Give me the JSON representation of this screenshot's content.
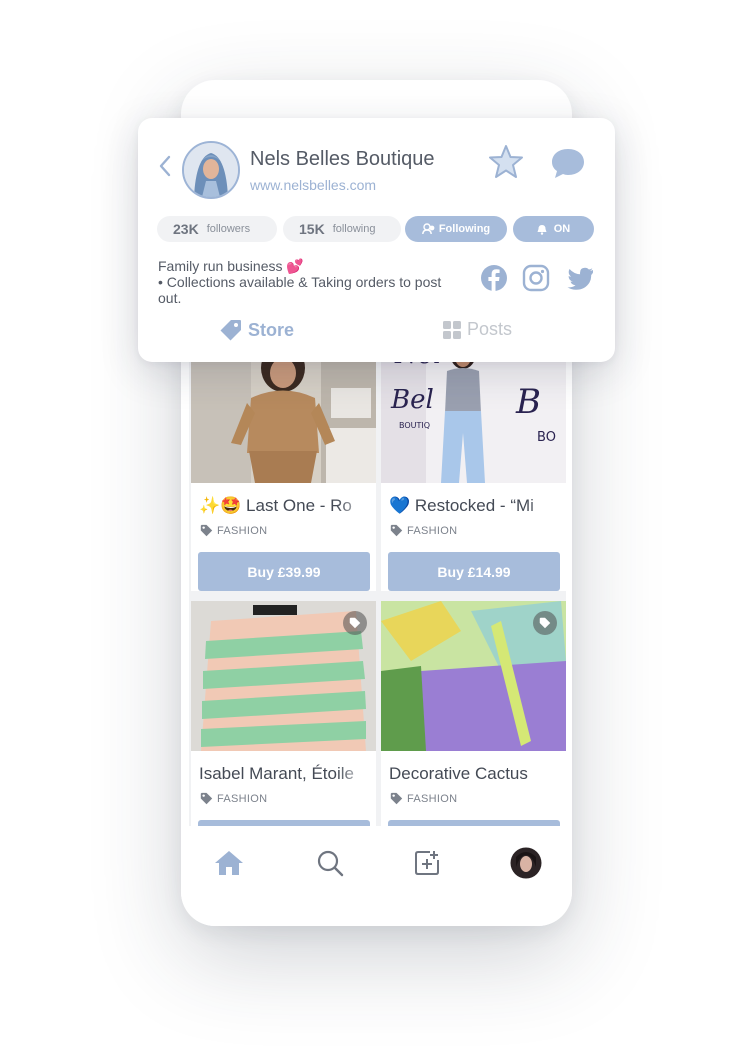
{
  "profile": {
    "name": "Nels Belles Boutique",
    "url": "www.nelsbelles.com",
    "followers_count": "23K",
    "followers_label": "followers",
    "following_count": "15K",
    "following_label": "following",
    "following_button": "Following",
    "notify_button": "ON",
    "bio_line1": "Family run business 💕",
    "bio_line2": "• Collections available & Taking orders to post",
    "bio_line3": "out."
  },
  "segments": {
    "store": "Store",
    "posts": "Posts"
  },
  "products": [
    {
      "title": "✨🤩 Last One - Ro",
      "category": "FASHION",
      "buy": "Buy £39.99"
    },
    {
      "title": "💙 Restocked - “Mi",
      "category": "FASHION",
      "buy": "Buy £14.99"
    },
    {
      "title": "Isabel Marant, Étoile",
      "category": "FASHION",
      "buy": ""
    },
    {
      "title": "Decorative Cactus",
      "category": "FASHION",
      "buy": ""
    }
  ],
  "tabs": [
    "home-icon",
    "search-icon",
    "add-post-icon",
    "profile-avatar"
  ],
  "colors": {
    "accent": "#9cb2d3",
    "button": "#a7bcdb",
    "text": "#555b66",
    "muted": "#c3c7cd"
  }
}
